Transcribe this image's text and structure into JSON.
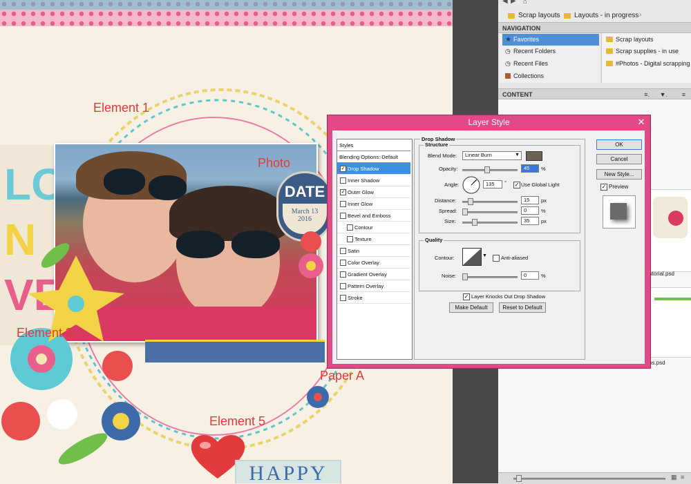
{
  "canvas": {
    "labels": {
      "element1": "Element 1",
      "photo": "Photo",
      "element3": "Element 3",
      "paperA": "Paper A",
      "element5": "Element 5"
    },
    "big_letters": [
      "LO",
      "N",
      "VE"
    ],
    "date_badge": {
      "title": "DATE",
      "date": "March 13",
      "year": "2016"
    },
    "bottom_word": "HAPPY"
  },
  "bridge": {
    "breadcrumbs": [
      "Scrap layouts",
      "Layouts - in progress"
    ],
    "navigation_header": "NAVIGATION",
    "favorites": [
      {
        "label": "Favorites",
        "icon": "star-icon",
        "selected": true
      },
      {
        "label": "Recent Folders",
        "icon": "recent-folders-icon",
        "selected": false
      },
      {
        "label": "Recent Files",
        "icon": "recent-files-icon",
        "selected": false
      },
      {
        "label": "Collections",
        "icon": "collections-icon",
        "selected": false
      }
    ],
    "folders": [
      "Scrap layouts",
      "Scrap supplies - in use",
      "#Photos - Digital scrapping (c"
    ],
    "content_header": "CONTENT",
    "content_captions": [
      "utorial.psd",
      "ps.psd"
    ]
  },
  "dialog": {
    "title": "Layer Style",
    "close": "✕",
    "styles": [
      {
        "label": "Styles",
        "checkbox": false,
        "checked": false,
        "selected": false
      },
      {
        "label": "Blending Options: Default",
        "checkbox": false,
        "checked": false,
        "selected": false
      },
      {
        "label": "Drop Shadow",
        "checkbox": true,
        "checked": true,
        "selected": true
      },
      {
        "label": "Inner Shadow",
        "checkbox": true,
        "checked": false,
        "selected": false
      },
      {
        "label": "Outer Glow",
        "checkbox": true,
        "checked": true,
        "selected": false
      },
      {
        "label": "Inner Glow",
        "checkbox": true,
        "checked": false,
        "selected": false
      },
      {
        "label": "Bevel and Emboss",
        "checkbox": true,
        "checked": false,
        "selected": false
      },
      {
        "label": "Contour",
        "checkbox": true,
        "checked": false,
        "selected": false,
        "indent": true
      },
      {
        "label": "Texture",
        "checkbox": true,
        "checked": false,
        "selected": false,
        "indent": true
      },
      {
        "label": "Satin",
        "checkbox": true,
        "checked": false,
        "selected": false
      },
      {
        "label": "Color Overlay",
        "checkbox": true,
        "checked": false,
        "selected": false
      },
      {
        "label": "Gradient Overlay",
        "checkbox": true,
        "checked": false,
        "selected": false
      },
      {
        "label": "Pattern Overlay",
        "checkbox": true,
        "checked": false,
        "selected": false
      },
      {
        "label": "Stroke",
        "checkbox": true,
        "checked": false,
        "selected": false
      }
    ],
    "drop_shadow": {
      "section_title": "Drop Shadow",
      "structure_title": "Structure",
      "blend_mode_label": "Blend Mode:",
      "blend_mode_value": "Linear Burn",
      "shadow_color": "#6b6352",
      "opacity_label": "Opacity:",
      "opacity_value": "45",
      "angle_label": "Angle:",
      "angle_value": "135",
      "degree_symbol": "°",
      "use_global_light_label": "Use Global Light",
      "use_global_light_checked": true,
      "distance_label": "Distance:",
      "distance_value": "15",
      "spread_label": "Spread:",
      "spread_value": "0",
      "size_label": "Size:",
      "size_value": "35",
      "unit_percent": "%",
      "unit_px": "px",
      "quality_title": "Quality",
      "contour_label": "Contour:",
      "anti_aliased_label": "Anti-aliased",
      "anti_aliased_checked": false,
      "noise_label": "Noise:",
      "noise_value": "0",
      "knockout_label": "Layer Knocks Out Drop Shadow",
      "knockout_checked": true,
      "make_default_label": "Make Default",
      "reset_default_label": "Reset to Default"
    },
    "buttons": {
      "ok": "OK",
      "cancel": "Cancel",
      "new_style": "New Style...",
      "preview_label": "Preview",
      "preview_checked": true
    }
  }
}
